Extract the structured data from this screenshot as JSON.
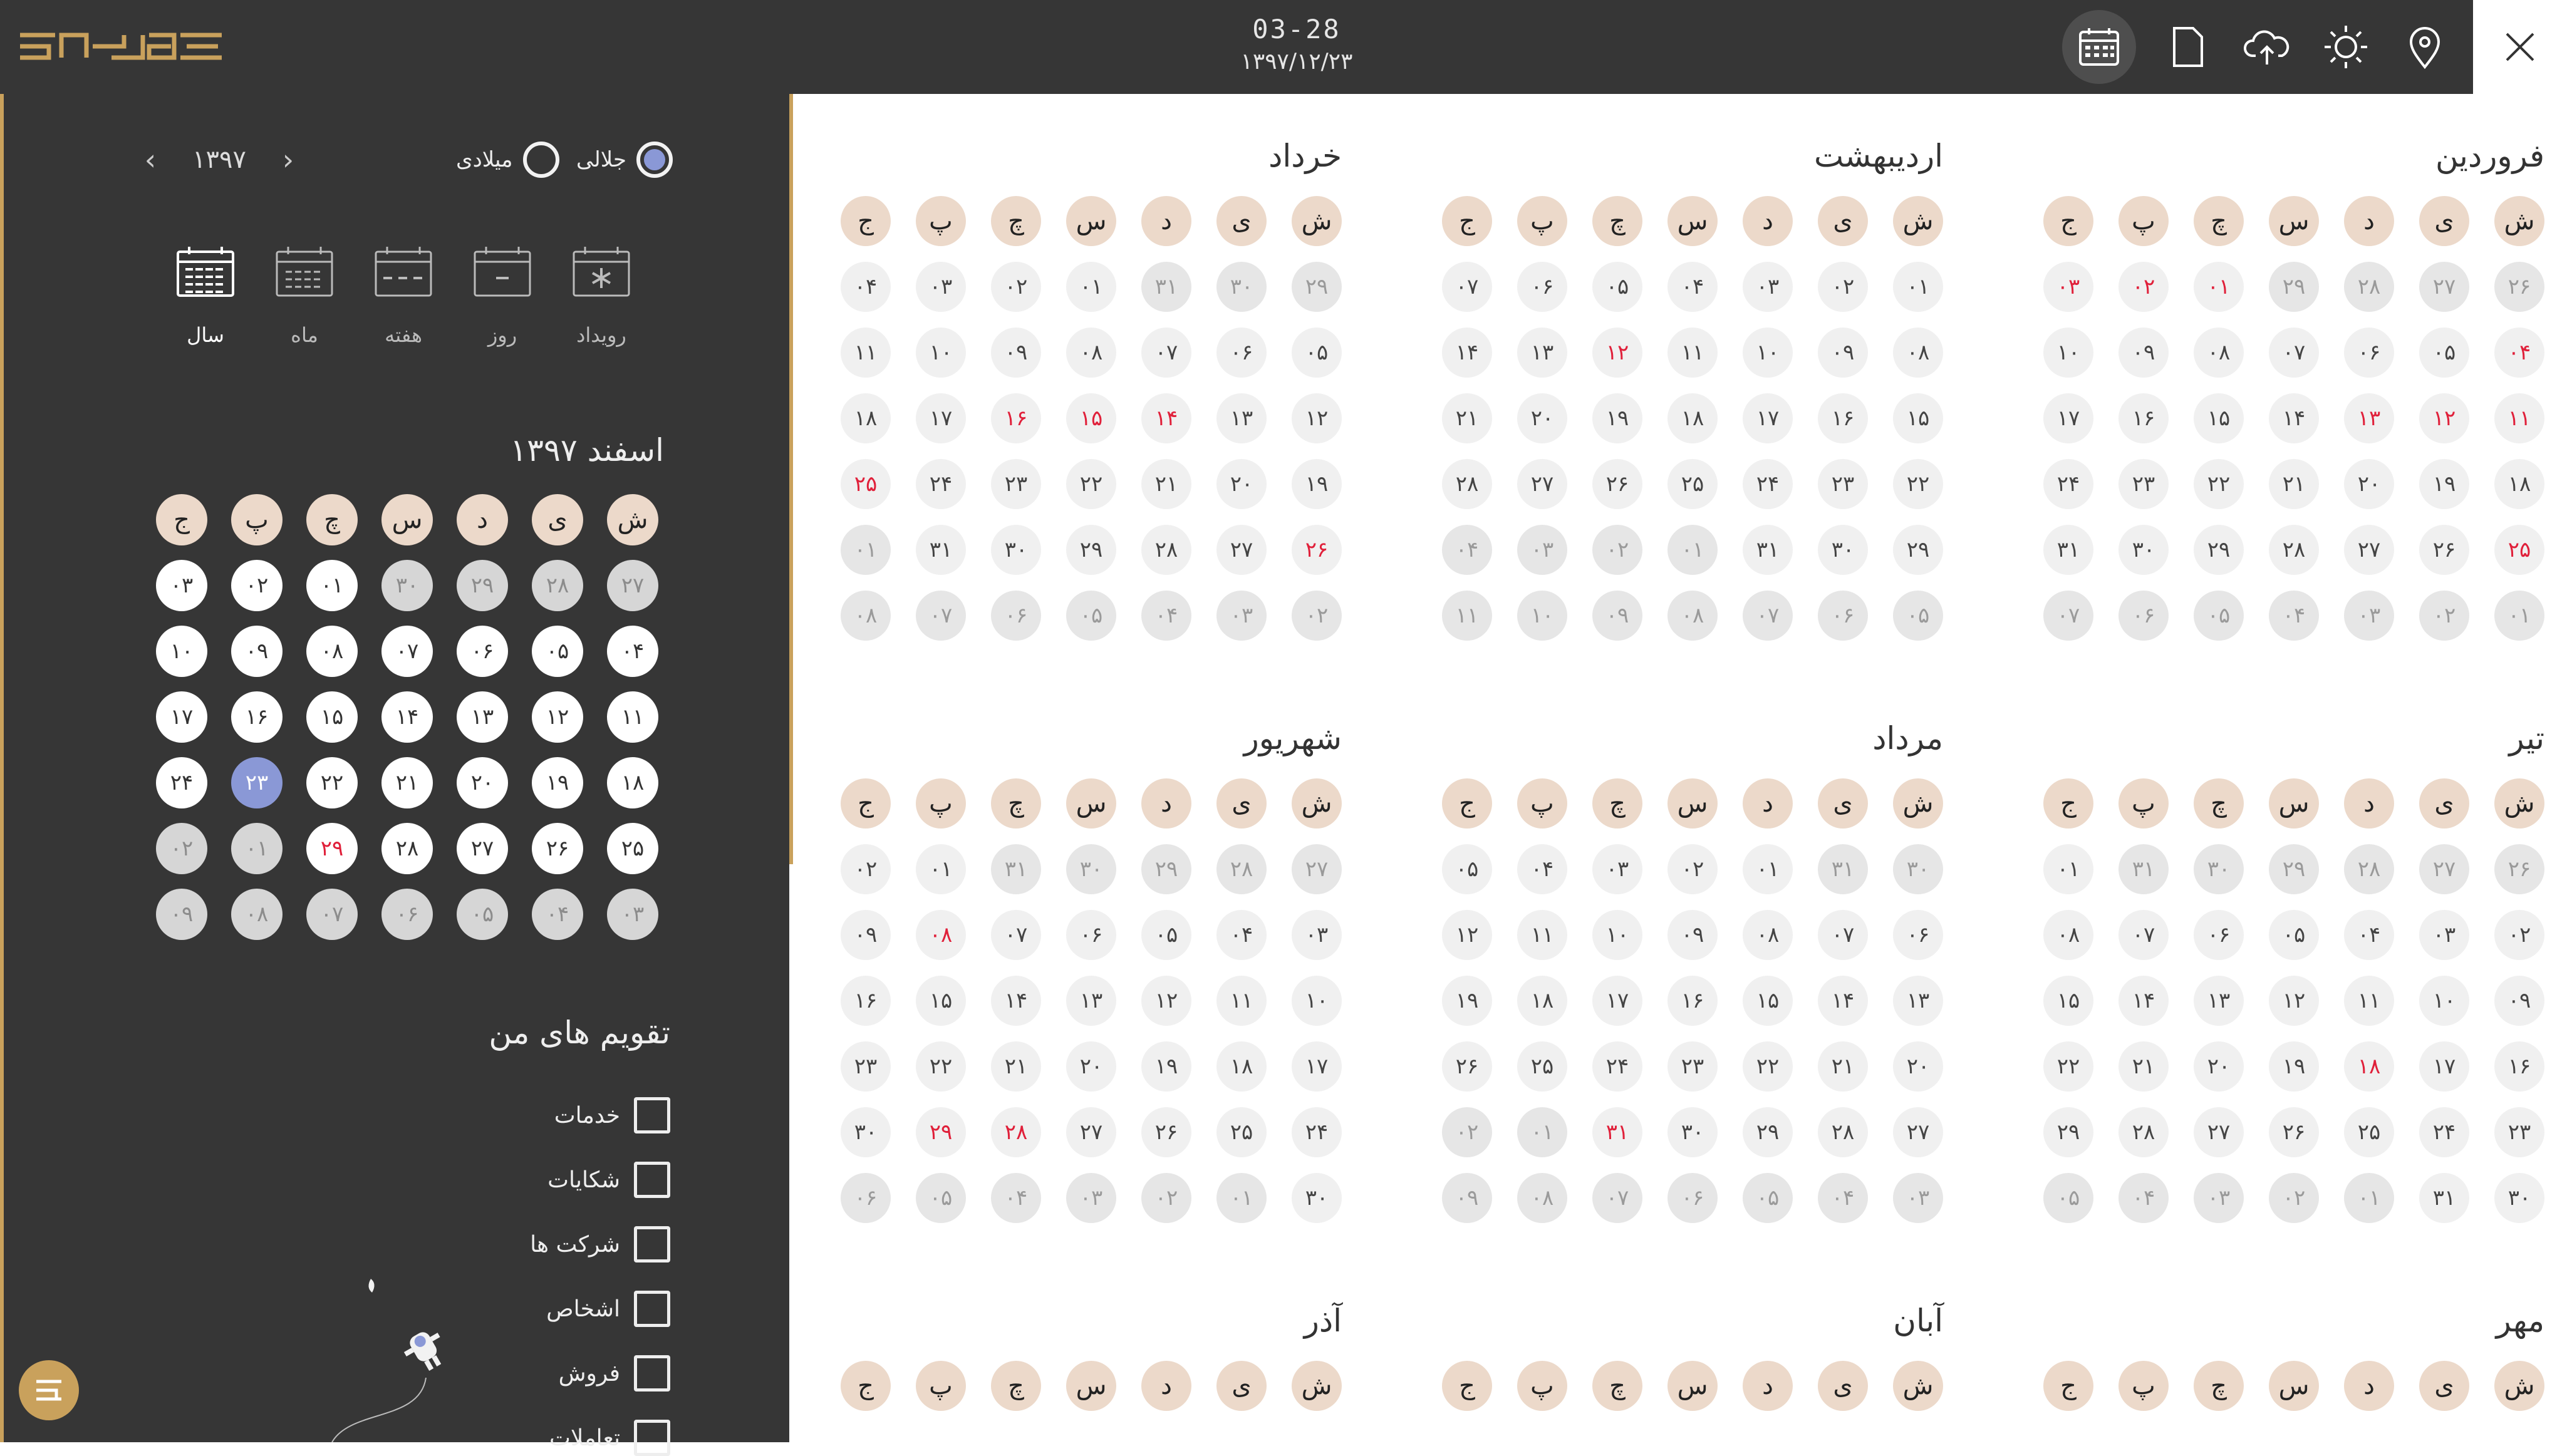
{
  "header": {
    "time": "03-28",
    "date": "۱۳۹۷/۱۲/۲۳",
    "tools": [
      {
        "icon": "calendar-icon",
        "active": true
      },
      {
        "icon": "document-icon"
      },
      {
        "icon": "cloud-upload-icon"
      },
      {
        "icon": "weather-sun-icon"
      },
      {
        "icon": "location-pin-icon"
      }
    ],
    "close_icon": "close-icon"
  },
  "sidebar": {
    "calendar_type": {
      "jalali": "جلالی",
      "gregorian": "میلادی",
      "selected": "jalali"
    },
    "year": "۱۳۹۷",
    "views": [
      {
        "label": "رویداد",
        "icon": "event-view-icon"
      },
      {
        "label": "روز",
        "icon": "day-view-icon"
      },
      {
        "label": "هفته",
        "icon": "week-view-icon"
      },
      {
        "label": "ماه",
        "icon": "month-view-icon"
      },
      {
        "label": "سال",
        "icon": "year-view-icon",
        "active": true
      }
    ],
    "mini_month": {
      "title": "اسفند ۱۳۹۷",
      "headers": [
        "ش",
        "ی",
        "د",
        "س",
        "چ",
        "پ",
        "ج"
      ],
      "weeks": [
        [
          "p27",
          "p28",
          "p29",
          "p30",
          "01",
          "02",
          "03"
        ],
        [
          "04",
          "05",
          "06",
          "07",
          "08",
          "09",
          "10"
        ],
        [
          "11",
          "12",
          "13",
          "14",
          "15",
          "16",
          "17"
        ],
        [
          "18",
          "19",
          "20",
          "21",
          "22",
          "*23",
          "24"
        ],
        [
          "25",
          "26",
          "27",
          "28",
          "h29",
          "n01",
          "n02"
        ],
        [
          "n03",
          "n04",
          "n05",
          "n06",
          "n07",
          "n08",
          "n09"
        ]
      ]
    },
    "my_calendars": {
      "title": "تقویم های من",
      "items": [
        "خدمات",
        "شکایات",
        "شرکت ها",
        "اشخاص",
        "فروش",
        "تعاملات"
      ]
    }
  },
  "year": {
    "colors": {
      "accent": "#c9a15c",
      "header": "#ecd9ca",
      "selected": "#8a98d6",
      "holiday": "#e0203a"
    },
    "headers": [
      "ش",
      "ی",
      "د",
      "س",
      "چ",
      "پ",
      "ج"
    ],
    "months": [
      {
        "name": "فروردین",
        "weeks": [
          [
            "p26",
            "p27",
            "p28",
            "p29",
            "h01",
            "h02",
            "h03"
          ],
          [
            "h04",
            "05",
            "06",
            "07",
            "08",
            "09",
            "10"
          ],
          [
            "h11",
            "h12",
            "h13",
            "14",
            "15",
            "16",
            "17"
          ],
          [
            "18",
            "19",
            "20",
            "21",
            "22",
            "23",
            "24"
          ],
          [
            "h25",
            "26",
            "27",
            "28",
            "29",
            "30",
            "31"
          ],
          [
            "n01",
            "n02",
            "n03",
            "n04",
            "n05",
            "n06",
            "n07"
          ]
        ]
      },
      {
        "name": "اردیبهشت",
        "weeks": [
          [
            "01",
            "02",
            "03",
            "04",
            "05",
            "06",
            "07"
          ],
          [
            "08",
            "09",
            "10",
            "11",
            "h12",
            "13",
            "14"
          ],
          [
            "15",
            "16",
            "17",
            "18",
            "19",
            "20",
            "21"
          ],
          [
            "22",
            "23",
            "24",
            "25",
            "26",
            "27",
            "28"
          ],
          [
            "29",
            "30",
            "31",
            "n01",
            "n02",
            "n03",
            "n04"
          ],
          [
            "n05",
            "n06",
            "n07",
            "n08",
            "n09",
            "n10",
            "n11"
          ]
        ]
      },
      {
        "name": "خرداد",
        "weeks": [
          [
            "p29",
            "p30",
            "p31",
            "01",
            "02",
            "03",
            "04"
          ],
          [
            "05",
            "06",
            "07",
            "08",
            "09",
            "10",
            "11"
          ],
          [
            "12",
            "13",
            "h14",
            "h15",
            "h16",
            "17",
            "18"
          ],
          [
            "19",
            "20",
            "21",
            "22",
            "23",
            "24",
            "h25"
          ],
          [
            "h26",
            "27",
            "28",
            "29",
            "30",
            "31",
            "n01"
          ],
          [
            "n02",
            "n03",
            "n04",
            "n05",
            "n06",
            "n07",
            "n08"
          ]
        ]
      },
      {
        "name": "تیر",
        "weeks": [
          [
            "p26",
            "p27",
            "p28",
            "p29",
            "p30",
            "p31",
            "01"
          ],
          [
            "02",
            "03",
            "04",
            "05",
            "06",
            "07",
            "08"
          ],
          [
            "09",
            "10",
            "11",
            "12",
            "13",
            "14",
            "15"
          ],
          [
            "16",
            "17",
            "h18",
            "19",
            "20",
            "21",
            "22"
          ],
          [
            "23",
            "24",
            "25",
            "26",
            "27",
            "28",
            "29"
          ],
          [
            "30",
            "31",
            "n01",
            "n02",
            "n03",
            "n04",
            "n05"
          ]
        ]
      },
      {
        "name": "مرداد",
        "weeks": [
          [
            "p30",
            "p31",
            "01",
            "02",
            "03",
            "04",
            "05"
          ],
          [
            "06",
            "07",
            "08",
            "09",
            "10",
            "11",
            "12"
          ],
          [
            "13",
            "14",
            "15",
            "16",
            "17",
            "18",
            "19"
          ],
          [
            "20",
            "21",
            "22",
            "23",
            "24",
            "25",
            "26"
          ],
          [
            "27",
            "28",
            "29",
            "30",
            "h31",
            "n01",
            "n02"
          ],
          [
            "n03",
            "n04",
            "n05",
            "n06",
            "n07",
            "n08",
            "n09"
          ]
        ]
      },
      {
        "name": "شهریور",
        "weeks": [
          [
            "p27",
            "p28",
            "p29",
            "p30",
            "p31",
            "01",
            "02"
          ],
          [
            "03",
            "04",
            "05",
            "06",
            "07",
            "h08",
            "09"
          ],
          [
            "10",
            "11",
            "12",
            "13",
            "14",
            "15",
            "16"
          ],
          [
            "17",
            "18",
            "19",
            "20",
            "21",
            "22",
            "23"
          ],
          [
            "24",
            "25",
            "26",
            "27",
            "h28",
            "h29",
            "30"
          ],
          [
            "30",
            "n01",
            "n02",
            "n03",
            "n04",
            "n05",
            "n06"
          ]
        ]
      },
      {
        "name": "مهر",
        "weeks": []
      },
      {
        "name": "آبان",
        "weeks": []
      },
      {
        "name": "آذر",
        "weeks": []
      }
    ]
  }
}
